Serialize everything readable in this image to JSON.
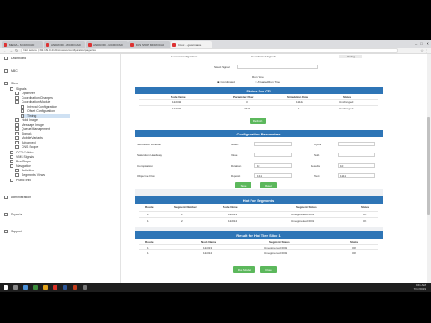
{
  "browser": {
    "tabs": [
      {
        "title": "MEDIA - MICROCAD"
      },
      {
        "title": "ANDROID - MICROCAD"
      },
      {
        "title": "ANDROID - MICROCAD"
      },
      {
        "title": "BUS STOP MICROCAD"
      },
      {
        "title": "Inbox ...governance"
      }
    ],
    "url": "Not secure | 192.168.0.21/Microwave/configuration/pages/ss"
  },
  "sidebar": {
    "items": [
      {
        "label": "Dashboard"
      },
      {
        "label": "MBC"
      },
      {
        "label": "Sites"
      },
      {
        "label": "Signals"
      },
      {
        "label": "Optimizer"
      },
      {
        "label": "Coordination Changes"
      },
      {
        "label": "Coordination Module"
      },
      {
        "label": "Interval Configuration"
      },
      {
        "label": "Offset Configuration"
      },
      {
        "label": "Timing"
      },
      {
        "label": "Hold Image"
      },
      {
        "label": "Message Image"
      },
      {
        "label": "Queue Management"
      },
      {
        "label": "Signals"
      },
      {
        "label": "Mobile Variants"
      },
      {
        "label": "Advanced"
      },
      {
        "label": "CNS Scope"
      },
      {
        "label": "CCTV Video"
      },
      {
        "label": "VMS Signals"
      },
      {
        "label": "Bus Stops"
      },
      {
        "label": "Navigation"
      },
      {
        "label": "Activities"
      },
      {
        "label": "Segments Views"
      },
      {
        "label": "Public Info"
      },
      {
        "label": "Administration"
      },
      {
        "label": "Reports"
      },
      {
        "label": "Support"
      }
    ]
  },
  "main": {
    "top_tabs": [
      "General Configuration",
      "Coordinated Signals",
      "Timing"
    ],
    "select_label": "Select Signal",
    "select_value": "",
    "run_time_label": "Run Time",
    "radio_a": "Coordinated",
    "radio_b": "Actuated Run Time",
    "cti_header": "Status For CTI",
    "cti_columns": [
      "Node Name",
      "Parameter Flow",
      "Simulation Flow",
      "Status"
    ],
    "cti_rows": [
      [
        "122313",
        "3",
        "11122",
        "Unchanged"
      ],
      [
        "122314",
        "4711",
        "1",
        "Unchanged"
      ]
    ],
    "cti_button": "Refresh",
    "config_header": "Configuration Parameters",
    "config_fields": [
      {
        "label": "Simulation Duration",
        "sub": "Green",
        "sub2": "Cycle"
      },
      {
        "label": "Saturation Headway",
        "sub": "Value",
        "sub2": "Sub"
      },
      {
        "label": "Computation",
        "sub": "Duration",
        "value": "10",
        "sub2": "Results",
        "value2": "10"
      },
      {
        "label": "Objective Flow",
        "sub": "Deposit",
        "value": "1111",
        "sub2": "Text",
        "value2": "1111"
      }
    ],
    "config_buttons": [
      "Save",
      "Reset"
    ],
    "hot_header": "Hot For Segments",
    "hot_columns": [
      "Route",
      "Segment Number",
      "Node Name",
      "Segment Status",
      "Status"
    ],
    "hot_rows": [
      [
        "1",
        "1",
        "122313",
        "Unsegmented 0001",
        "OK"
      ],
      [
        "1",
        "2",
        "122314",
        "Unsegmented 0001",
        "OK"
      ]
    ],
    "result_header": "Result for Hot Tier, Slice 1",
    "result_columns": [
      "Route",
      "Node Name",
      "Segment Status",
      "Status"
    ],
    "result_rows": [
      [
        "1",
        "122313",
        "Unsegmented 0001",
        "OK"
      ],
      [
        "1",
        "122314",
        "Unsegmented 0001",
        "OK"
      ]
    ],
    "bottom_buttons": [
      "Run Model",
      "Close"
    ]
  },
  "clock": {
    "time": "9:51 AM",
    "date": "7/17/2019"
  }
}
